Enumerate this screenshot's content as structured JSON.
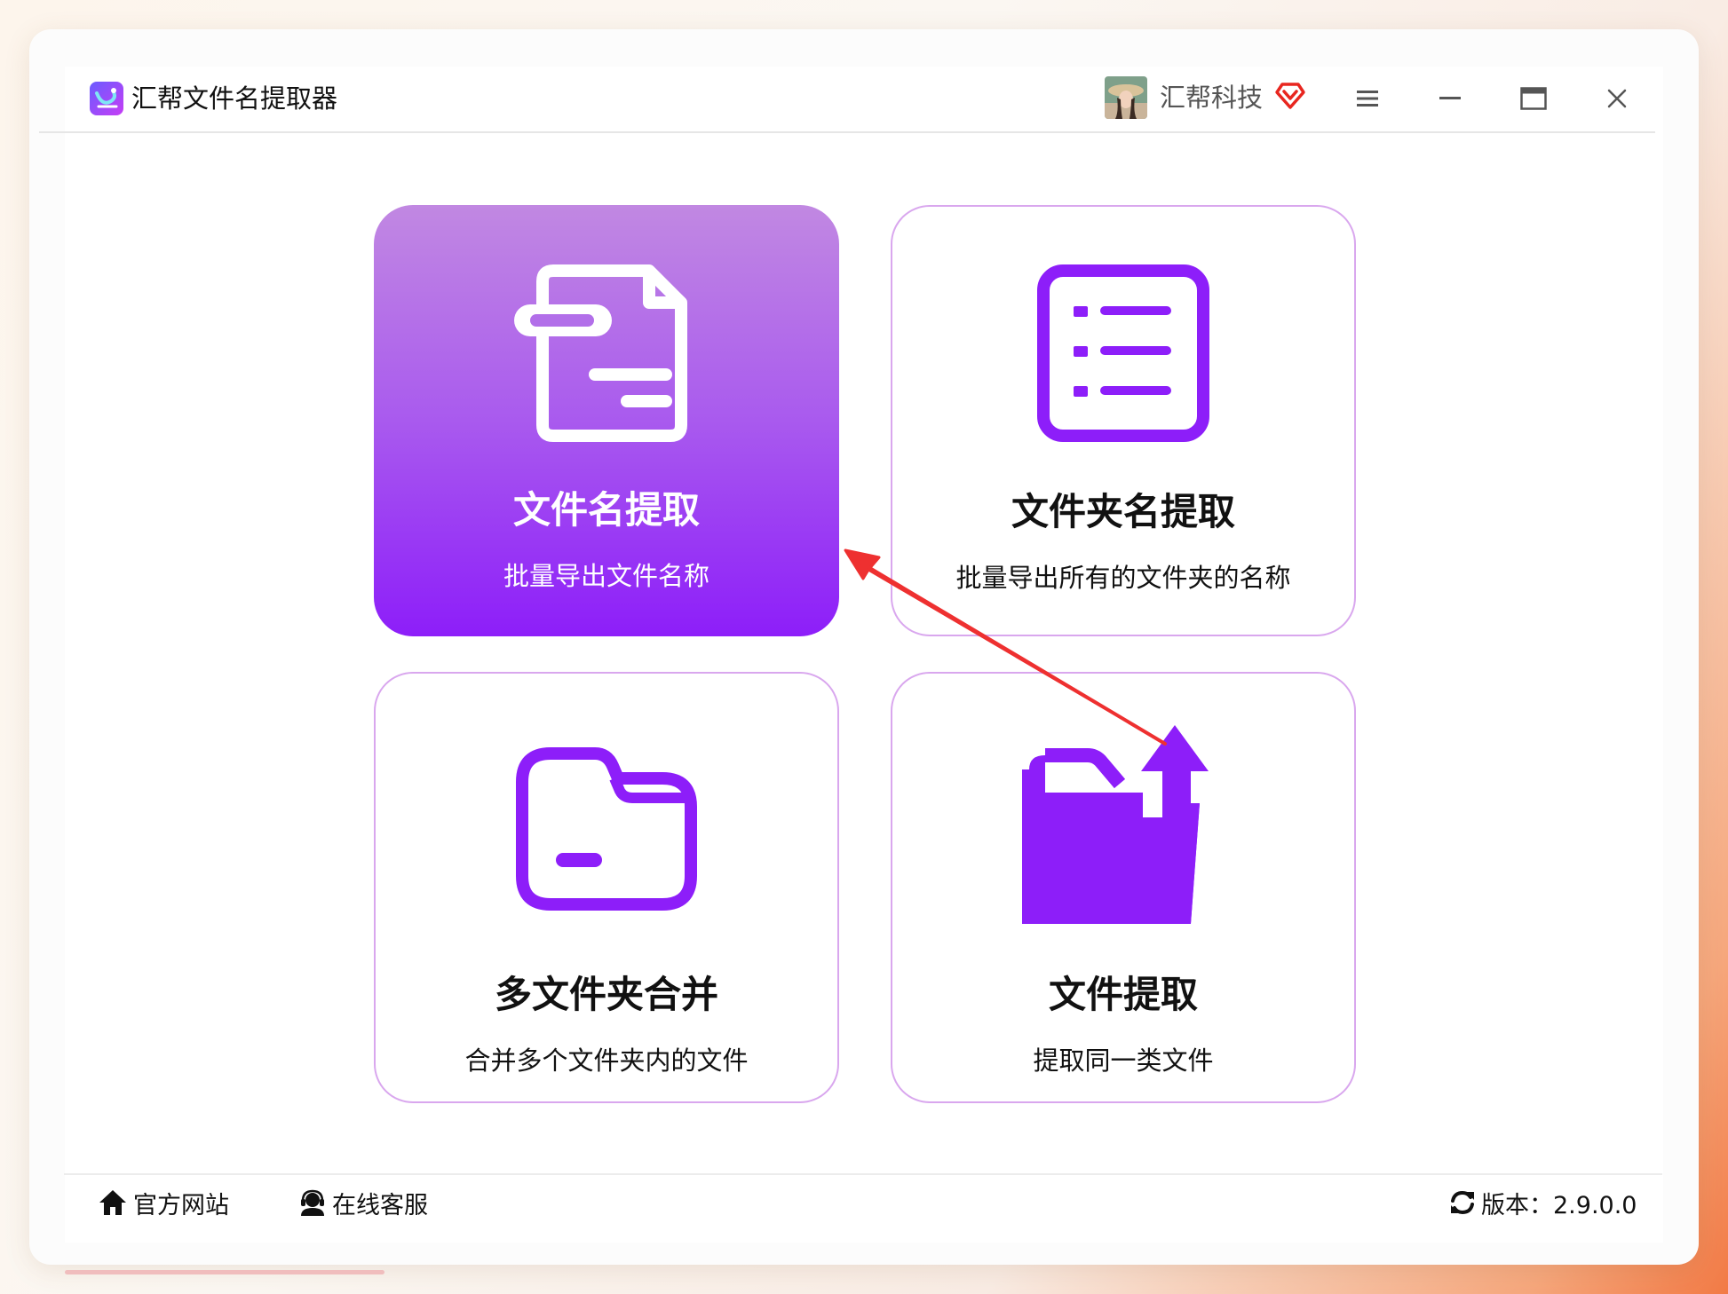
{
  "app": {
    "title": "汇帮文件名提取器",
    "user_name": "汇帮科技"
  },
  "cards": [
    {
      "title": "文件名提取",
      "subtitle": "批量导出文件名称",
      "icon": "document-icon",
      "active": true
    },
    {
      "title": "文件夹名提取",
      "subtitle": "批量导出所有的文件夹的名称",
      "icon": "list-icon",
      "active": false
    },
    {
      "title": "多文件夹合并",
      "subtitle": "合并多个文件夹内的文件",
      "icon": "folder-icon",
      "active": false
    },
    {
      "title": "文件提取",
      "subtitle": "提取同一类文件",
      "icon": "folder-upload-icon",
      "active": false
    }
  ],
  "footer": {
    "website": "官方网站",
    "support": "在线客服",
    "version": "版本：2.9.0.0"
  },
  "colors": {
    "accent": "#8d1ef9",
    "card_border": "#d9a7ee",
    "annotation_arrow": "#ee3030"
  }
}
